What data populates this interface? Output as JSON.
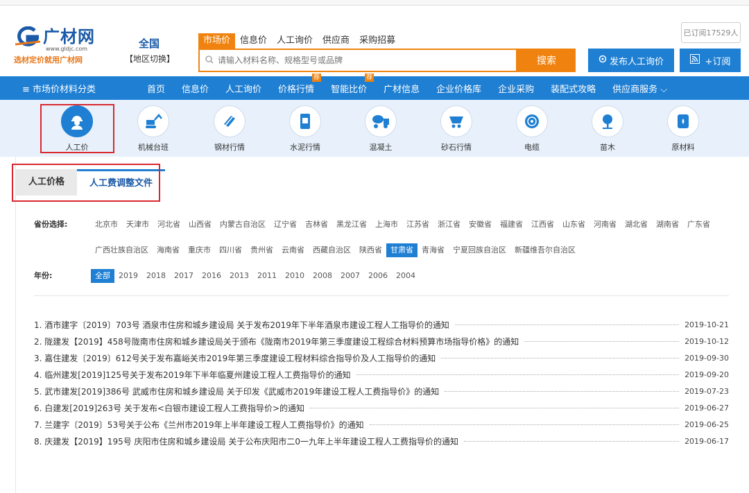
{
  "header": {
    "logo_name": "广材网",
    "logo_url": "www.gldjc.com",
    "logo_slogan": "选材定价就用广材网",
    "region_name": "全国",
    "region_switch": "【地区切换】",
    "search_tabs": [
      "市场价",
      "信息价",
      "人工询价",
      "供应商",
      "采购招募"
    ],
    "search_placeholder": "请输入材料名称、规格型号或品牌",
    "search_button": "搜索",
    "publish_button": "发布人工询价",
    "subscribe_button": "+订阅",
    "subscribed_count": "已订阅17529人"
  },
  "nav": {
    "category": "≡ 市场价材料分类",
    "items": [
      {
        "label": "首页"
      },
      {
        "label": "信息价"
      },
      {
        "label": "人工询价"
      },
      {
        "label": "价格行情",
        "badge": "荐"
      },
      {
        "label": "智能比价",
        "badge": "荐"
      },
      {
        "label": "广材信息"
      },
      {
        "label": "企业价格库"
      },
      {
        "label": "企业采购"
      },
      {
        "label": "装配式攻略"
      },
      {
        "label": "供应商服务 ⌵"
      }
    ]
  },
  "categories": [
    {
      "label": "人工价",
      "icon": "worker-icon"
    },
    {
      "label": "机械台班",
      "icon": "excavator-icon"
    },
    {
      "label": "钢材行情",
      "icon": "steel-icon"
    },
    {
      "label": "水泥行情",
      "icon": "cement-icon"
    },
    {
      "label": "混凝土",
      "icon": "concrete-truck-icon"
    },
    {
      "label": "砂石行情",
      "icon": "cart-icon"
    },
    {
      "label": "电缆",
      "icon": "cable-icon"
    },
    {
      "label": "苗木",
      "icon": "tree-icon"
    },
    {
      "label": "原材料",
      "icon": "barrel-icon"
    }
  ],
  "tabs": [
    "人工价格",
    "人工费调整文件"
  ],
  "filters": {
    "province_label": "省份选择:",
    "provinces": [
      "北京市",
      "天津市",
      "河北省",
      "山西省",
      "内蒙古自治区",
      "辽宁省",
      "吉林省",
      "黑龙江省",
      "上海市",
      "江苏省",
      "浙江省",
      "安徽省",
      "福建省",
      "江西省",
      "山东省",
      "河南省",
      "湖北省",
      "湖南省",
      "广东省",
      "广西壮族自治区",
      "海南省",
      "重庆市",
      "四川省",
      "贵州省",
      "云南省",
      "西藏自治区",
      "陕西省",
      "甘肃省",
      "青海省",
      "宁夏回族自治区",
      "新疆维吾尔自治区"
    ],
    "province_selected": "甘肃省",
    "year_label": "年份:",
    "years": [
      "全部",
      "2019",
      "2018",
      "2017",
      "2016",
      "2013",
      "2011",
      "2010",
      "2008",
      "2007",
      "2006",
      "2004"
    ],
    "year_selected": "全部"
  },
  "documents": [
    {
      "title": "1. 酒市建字〔2019〕703号 酒泉市住房和城乡建设局 关于发布2019年下半年酒泉市建设工程人工指导价的通知",
      "date": "2019-10-21"
    },
    {
      "title": "2. 陇建发【2019】458号陇南市住房和城乡建设局关于颁布《陇南市2019年第三季度建设工程综合材料预算市场指导价格》的通知",
      "date": "2019-10-12"
    },
    {
      "title": "3. 嘉住建发〔2019〕612号关于发布嘉峪关市2019年第三季度建设工程材料综合指导价及人工指导价的通知",
      "date": "2019-09-30"
    },
    {
      "title": "4. 临州建发[2019]125号关于发布2019年下半年临夏州建设工程人工费指导价的通知",
      "date": "2019-09-20"
    },
    {
      "title": "5. 武市建发[2019]386号 武威市住房和城乡建设局 关于印发《武威市2019年建设工程人工费指导价》的通知",
      "date": "2019-07-23"
    },
    {
      "title": "6. 白建发[2019]263号 关于发布<白银市建设工程人工费指导价>的通知",
      "date": "2019-06-27"
    },
    {
      "title": "7. 兰建字〔2019〕53号关于公布《兰州市2019年上半年建设工程人工费指导价》的通知",
      "date": "2019-06-25"
    },
    {
      "title": "8. 庆建发【2019】195号 庆阳市住房和城乡建设局 关于公布庆阳市二0一九年上半年建设工程人工费指导价的通知",
      "date": "2019-06-17"
    }
  ],
  "colors": {
    "brand_blue": "#1e7fd3",
    "accent_orange": "#f0830f",
    "highlight_red": "#d9272e"
  }
}
